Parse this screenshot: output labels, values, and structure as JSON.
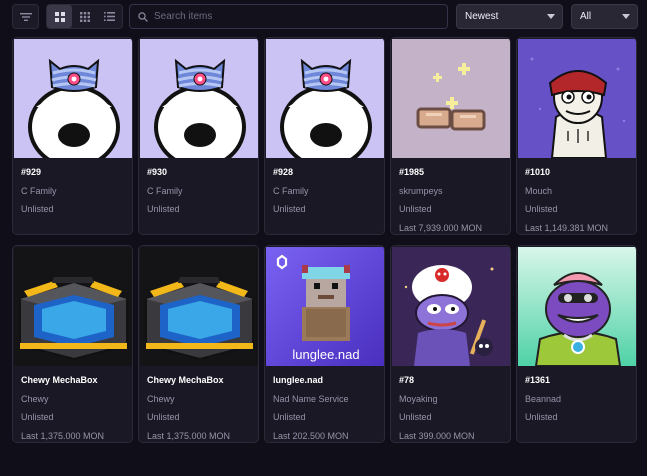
{
  "toolbar": {
    "filter_icon": "filter-icon",
    "views": [
      {
        "icon": "grid-large-icon",
        "active": true
      },
      {
        "icon": "grid-small-icon",
        "active": false
      },
      {
        "icon": "list-icon",
        "active": false
      }
    ],
    "search": {
      "placeholder": "Search items",
      "value": ""
    },
    "sort": {
      "value": "Newest"
    },
    "status": {
      "value": "All"
    }
  },
  "items": [
    {
      "name": "#929",
      "collection": "C Family",
      "status": "Unlisted",
      "price": "",
      "art": "cfamily"
    },
    {
      "name": "#930",
      "collection": "C Family",
      "status": "Unlisted",
      "price": "",
      "art": "cfamily"
    },
    {
      "name": "#928",
      "collection": "C Family",
      "status": "Unlisted",
      "price": "",
      "art": "cfamily"
    },
    {
      "name": "#1985",
      "collection": "skrumpeys",
      "status": "Unlisted",
      "price": "Last 7,939.000 MON",
      "art": "skrumpey"
    },
    {
      "name": "#1010",
      "collection": "Mouch",
      "status": "Unlisted",
      "price": "Last 1,149.381 MON",
      "art": "mouch"
    },
    {
      "name": "Chewy MechaBox",
      "collection": "Chewy",
      "status": "Unlisted",
      "price": "Last 1,375.000 MON",
      "art": "mechabox"
    },
    {
      "name": "Chewy MechaBox",
      "collection": "Chewy",
      "status": "Unlisted",
      "price": "Last 1,375.000 MON",
      "art": "mechabox"
    },
    {
      "name": "lunglee.nad",
      "collection": "Nad Name Service",
      "status": "Unlisted",
      "price": "Last 202.500 MON",
      "art": "lunglee",
      "art_text": "lunglee.nad"
    },
    {
      "name": "#78",
      "collection": "Moyaking",
      "status": "Unlisted",
      "price": "Last 399.000 MON",
      "art": "moyaking"
    },
    {
      "name": "#1361",
      "collection": "Beannad",
      "status": "Unlisted",
      "price": "",
      "art": "beannad"
    }
  ],
  "colors": {
    "background": "#100e18",
    "card": "#1b1825",
    "muted_text": "#9893aa",
    "cfamily_bg": "#cbc3f3"
  }
}
